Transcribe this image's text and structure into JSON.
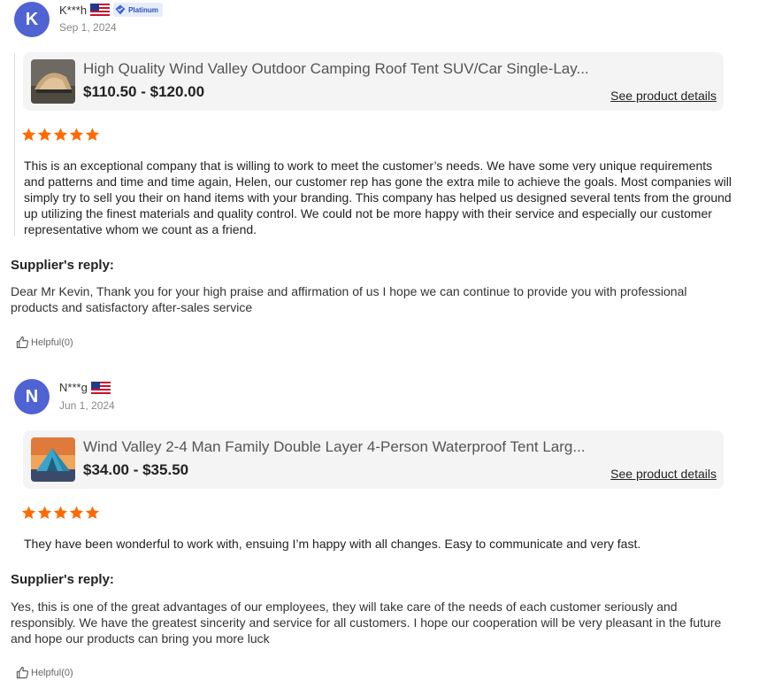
{
  "reviews": [
    {
      "avatar_letter": "K",
      "username": "K***h",
      "badge": "Platinum",
      "date": "Sep 1, 2024",
      "product": {
        "title": "High Quality Wind Valley Outdoor Camping Roof Tent SUV/Car Single-Lay...",
        "price": "$110.50 - $120.00",
        "link": "See product details"
      },
      "rating": 5,
      "text": "This is an exceptional company that is willing to work to meet the customer’s needs. We have some very unique requirements and patterns and time and time again, Helen, our customer rep has gone the extra mile to achieve the goals. Most companies will simply try to sell you their on hand items with your branding. This company has helped us designed several tents from the ground up utilizing the finest materials and quality control. We could not be more happy with their service and especially our customer representative whom we count as a friend.",
      "reply_heading": "Supplier's reply:",
      "reply_text": "Dear Mr Kevin, Thank you for your high praise and affirmation of us I hope we can continue to provide you with professional products and satisfactory after-sales service",
      "helpful": "Helpful(0)"
    },
    {
      "avatar_letter": "N",
      "username": "N***g",
      "date": "Jun 1, 2024",
      "product": {
        "title": "Wind Valley 2-4 Man Family Double Layer 4-Person Waterproof Tent Larg...",
        "price": "$34.00 - $35.50",
        "link": "See product details"
      },
      "rating": 5,
      "text": "They have been wonderful to work with, ensuing I’m happy with all changes. Easy to communicate and very fast.",
      "reply_heading": "Supplier's reply:",
      "reply_text": "Yes, this is one of the great advantages of our employees, they will take care of the needs of each customer seriously and responsibly. We have the greatest sincerity and service for all customers. I hope our cooperation will be very pleasant in the future and hope our products can bring you more luck",
      "helpful": "Helpful(0)"
    }
  ],
  "icons": {
    "flag": "us-flag-icon",
    "badge": "verified-diamond-icon",
    "star": "star-icon",
    "helpful": "thumbs-up-icon"
  },
  "colors": {
    "avatar": "#4f63d2",
    "star": "#ff6a00",
    "badge_text": "#2b4fb8"
  }
}
